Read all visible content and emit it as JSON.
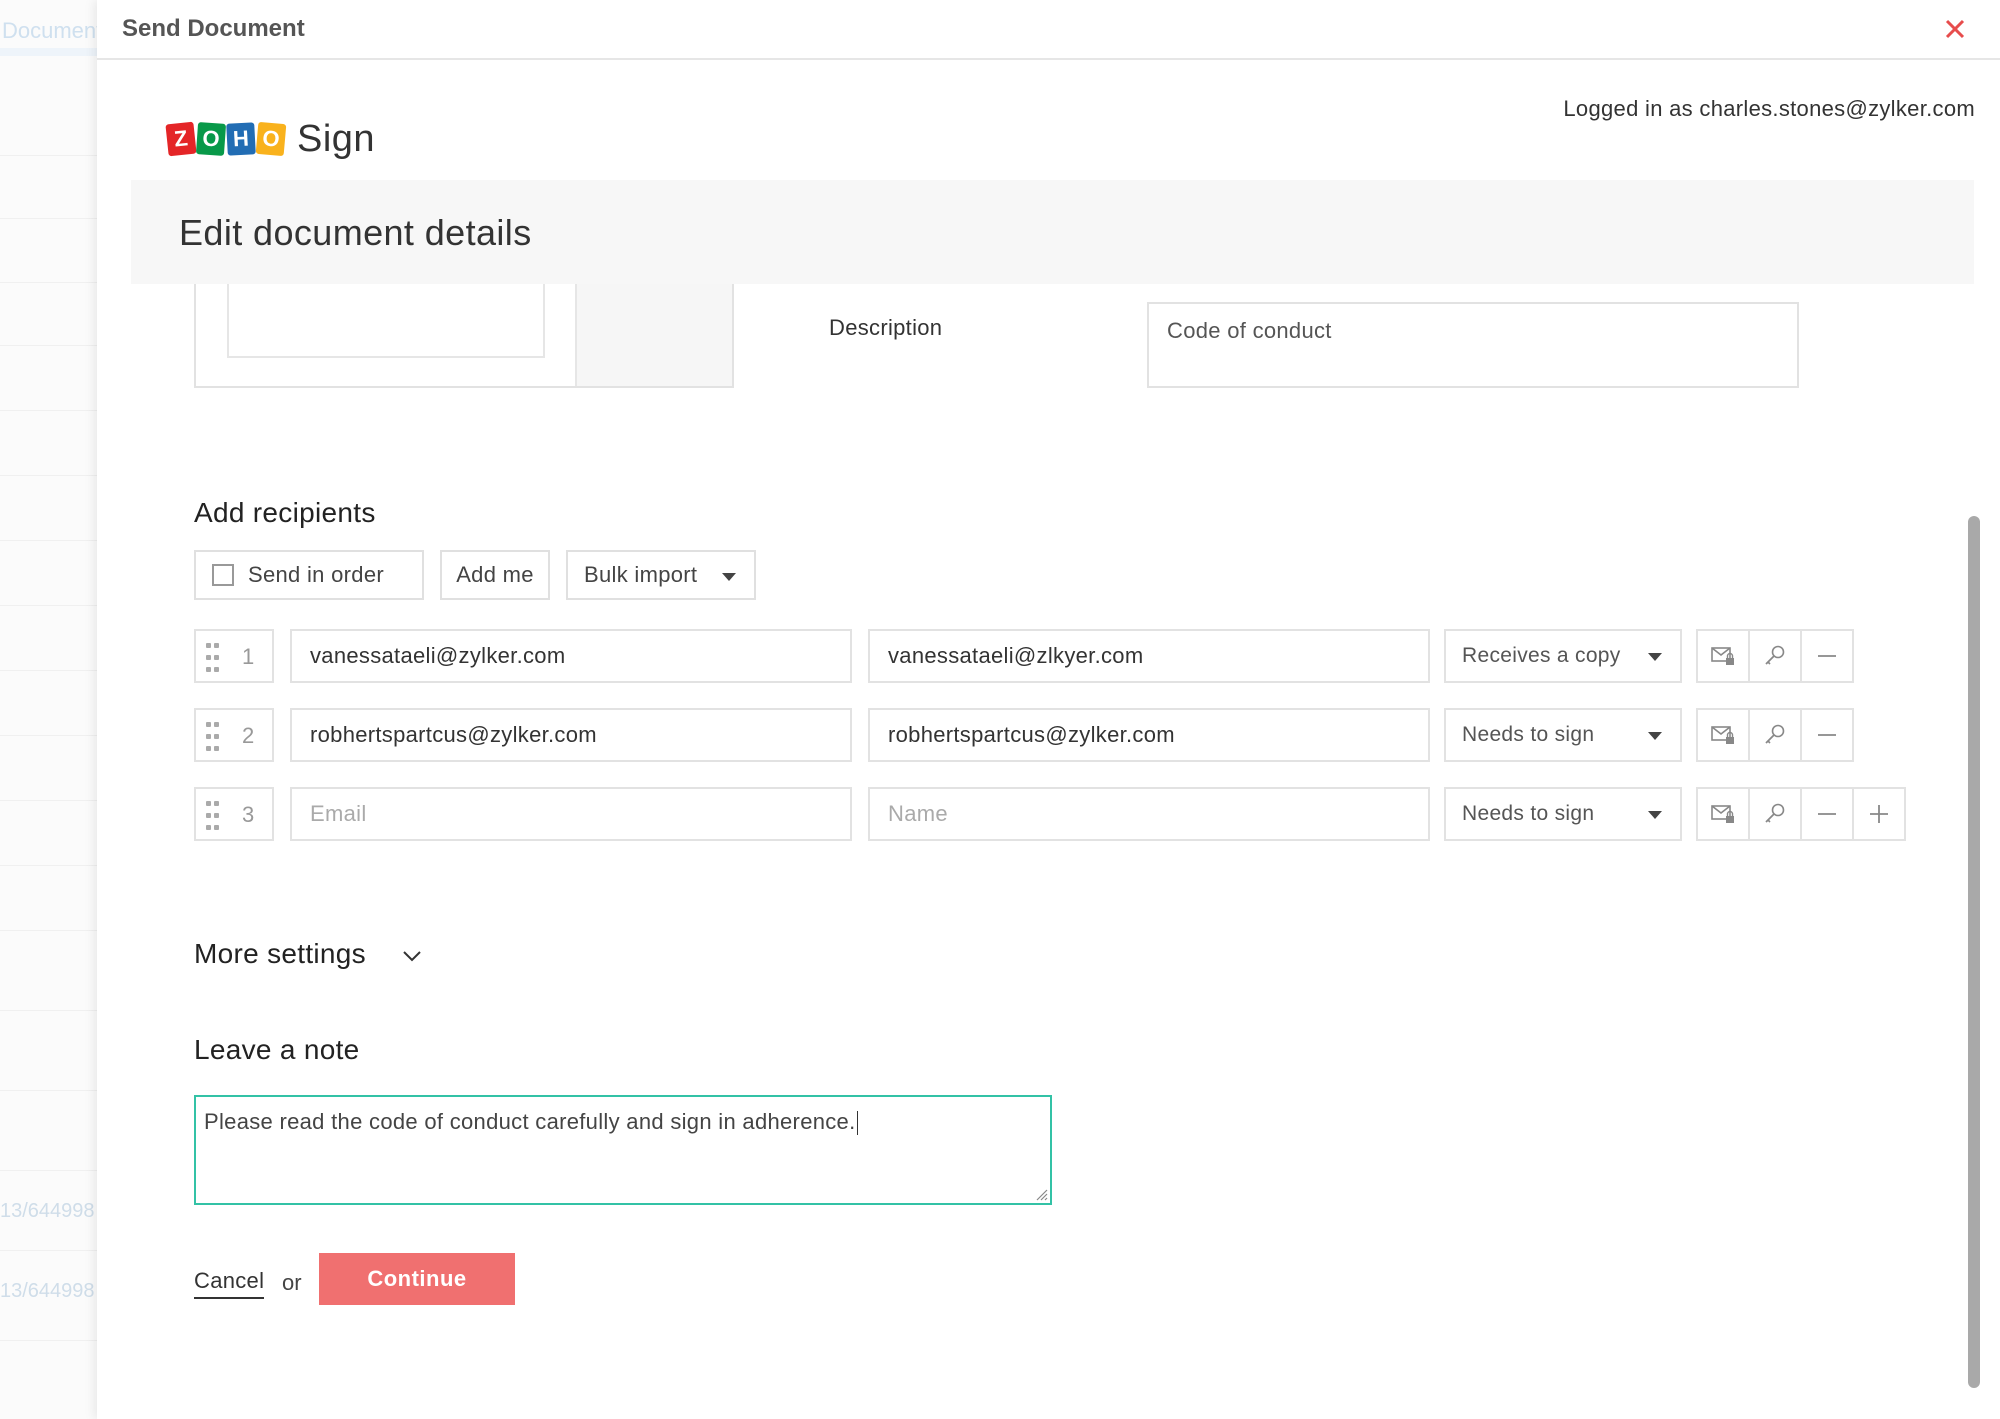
{
  "background": {
    "tab_label": "Documents",
    "row_ids": [
      "13/644998",
      "13/644998"
    ]
  },
  "modal": {
    "title": "Send Document",
    "close_icon": "close-icon"
  },
  "brand": {
    "letters": [
      "Z",
      "O",
      "H",
      "O"
    ],
    "letter_colors": [
      "#e42527",
      "#089949",
      "#226db4",
      "#f9b21d"
    ],
    "product": "Sign"
  },
  "logged_in_text": "Logged in as charles.stones@zylker.com",
  "edit_title": "Edit document details",
  "description": {
    "label": "Description",
    "value": "Code of conduct"
  },
  "recipients": {
    "title": "Add recipients",
    "send_in_order_label": "Send in order",
    "send_in_order_checked": false,
    "add_me_label": "Add me",
    "bulk_import_label": "Bulk import",
    "email_placeholder": "Email",
    "name_placeholder": "Name",
    "rows": [
      {
        "index": "1",
        "email": "vanessataeli@zylker.com",
        "name": "vanessataeli@zlkyer.com",
        "role": "Receives a copy"
      },
      {
        "index": "2",
        "email": "robhertspartcus@zylker.com",
        "name": "robhertspartcus@zylker.com",
        "role": "Needs to sign"
      },
      {
        "index": "3",
        "email": "",
        "name": "",
        "role": "Needs to sign"
      }
    ]
  },
  "more_settings_label": "More settings",
  "note": {
    "title": "Leave a note",
    "value": "Please read the code of conduct carefully and sign in adherence."
  },
  "actions": {
    "cancel_label": "Cancel",
    "or_text": "or",
    "continue_label": "Continue"
  },
  "colors": {
    "accent": "#f07070",
    "close": "#e74c4c",
    "note_border": "#33c2a6"
  }
}
